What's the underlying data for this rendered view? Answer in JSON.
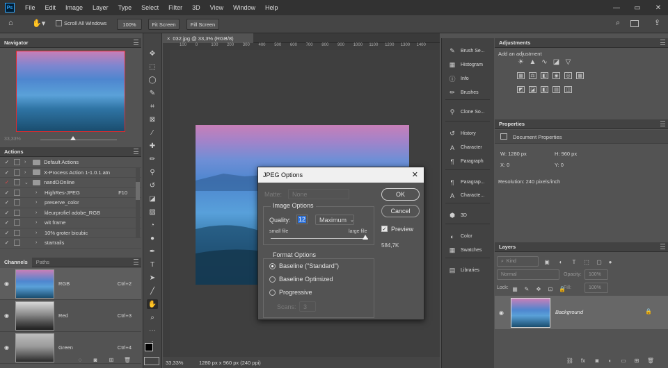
{
  "app": {
    "logo": "Ps"
  },
  "menu": [
    "File",
    "Edit",
    "Image",
    "Layer",
    "Type",
    "Select",
    "Filter",
    "3D",
    "View",
    "Window",
    "Help"
  ],
  "options_bar": {
    "scroll_all": "Scroll All Windows",
    "zoom": "100%",
    "fit": "Fit Screen",
    "fill": "Fill Screen"
  },
  "document": {
    "tab": "032.jpg @ 33,3% (RGB/8)",
    "zoom_status": "33,33%",
    "info_status": "1280 px x 960 px (240 ppi)"
  },
  "ruler": {
    "ticks": [
      "100",
      "0",
      "100",
      "200",
      "300",
      "400",
      "500",
      "600",
      "700",
      "800",
      "900",
      "1000",
      "1100",
      "1200",
      "1300",
      "1400"
    ]
  },
  "navigator": {
    "title": "Navigator",
    "zoom": "33,33%"
  },
  "actions": {
    "title": "Actions",
    "items": [
      {
        "label": "Default Actions",
        "type": "set",
        "key": ""
      },
      {
        "label": "X-Process Action 1-1.0.1.atn",
        "type": "set",
        "key": ""
      },
      {
        "label": "nandOOnline",
        "type": "set",
        "key": ""
      },
      {
        "label": "HighRes-JPEG",
        "type": "action",
        "key": "F10"
      },
      {
        "label": "preserve_color",
        "type": "action",
        "key": ""
      },
      {
        "label": "kleurprofiel adobe_RGB",
        "type": "action",
        "key": ""
      },
      {
        "label": "wit frame",
        "type": "action",
        "key": ""
      },
      {
        "label": "10% groter bicubic",
        "type": "action",
        "key": ""
      },
      {
        "label": "startrails",
        "type": "action",
        "key": ""
      }
    ]
  },
  "channels": {
    "tabs": [
      "Channels",
      "Paths"
    ],
    "items": [
      {
        "name": "RGB",
        "shortcut": "Ctrl+2"
      },
      {
        "name": "Red",
        "shortcut": "Ctrl+3"
      },
      {
        "name": "Green",
        "shortcut": "Ctrl+4"
      }
    ]
  },
  "dock": [
    {
      "label": "Brush Se...",
      "icon": "brush-settings-icon"
    },
    {
      "label": "Histogram",
      "icon": "histogram-icon"
    },
    {
      "label": "Info",
      "icon": "info-icon"
    },
    {
      "label": "Brushes",
      "icon": "brushes-icon"
    },
    {
      "label": "Clone So...",
      "icon": "clone-source-icon"
    },
    {
      "label": "History",
      "icon": "history-icon"
    },
    {
      "label": "Character",
      "icon": "character-icon"
    },
    {
      "label": "Paragraph",
      "icon": "paragraph-icon"
    },
    {
      "label": "Paragrap...",
      "icon": "paragraph-styles-icon"
    },
    {
      "label": "Characte...",
      "icon": "character-styles-icon"
    },
    {
      "label": "3D",
      "icon": "3d-icon"
    },
    {
      "label": "Color",
      "icon": "color-icon"
    },
    {
      "label": "Swatches",
      "icon": "swatches-icon"
    },
    {
      "label": "Libraries",
      "icon": "libraries-icon"
    }
  ],
  "adjustments": {
    "title": "Adjustments",
    "subtitle": "Add an adjustment"
  },
  "properties": {
    "title": "Properties",
    "section": "Document Properties",
    "w": "W:  1280 px",
    "h": "H:  960 px",
    "x": "X:  0",
    "y": "Y:  0",
    "resolution": "Resolution: 240 pixels/inch"
  },
  "layers": {
    "title": "Layers",
    "filter": "Kind",
    "blend": "Normal",
    "opacity_label": "Opacity:",
    "opacity": "100%",
    "lock_label": "Lock:",
    "fill_label": "Fill:",
    "fill": "100%",
    "layer_name": "Background"
  },
  "dialog": {
    "title": "JPEG Options",
    "matte_label": "Matte:",
    "matte_value": "None",
    "ok": "OK",
    "cancel": "Cancel",
    "preview": "Preview",
    "filesize": "584,7K",
    "image_options": "Image Options",
    "quality_label": "Quality:",
    "quality": "12",
    "quality_preset": "Maximum",
    "small": "small file",
    "large": "large file",
    "format_options": "Format Options",
    "baseline_standard": "Baseline (\"Standard\")",
    "baseline_optimized": "Baseline Optimized",
    "progressive": "Progressive",
    "scans_label": "Scans:",
    "scans": "3"
  },
  "colors": {
    "accent": "#31a8ff",
    "sky_top": "#c77fb8",
    "sky_mid": "#4e86cf",
    "hills": "#1a4d6e"
  }
}
